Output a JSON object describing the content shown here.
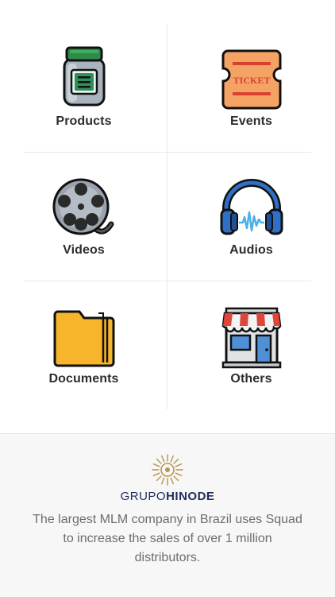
{
  "categories": [
    {
      "label": "Products",
      "icon": "jar-icon"
    },
    {
      "label": "Events",
      "icon": "ticket-icon"
    },
    {
      "label": "Videos",
      "icon": "film-reel-icon"
    },
    {
      "label": "Audios",
      "icon": "headphones-icon"
    },
    {
      "label": "Documents",
      "icon": "folder-icon"
    },
    {
      "label": "Others",
      "icon": "store-icon"
    }
  ],
  "ticket_text": "TICKET",
  "footer": {
    "logo_light": "GRUPO",
    "logo_bold": "HINODE",
    "tagline": "The largest MLM company in Brazil uses Squad to increase the sales of over 1 million distributors."
  },
  "colors": {
    "label": "#2d2d2d",
    "divider": "#e9e9e9",
    "footer_bg": "#f7f7f7",
    "logo_navy": "#1e2a5a",
    "logo_gold": "#b8944d",
    "tagline": "#6d6d6d"
  }
}
